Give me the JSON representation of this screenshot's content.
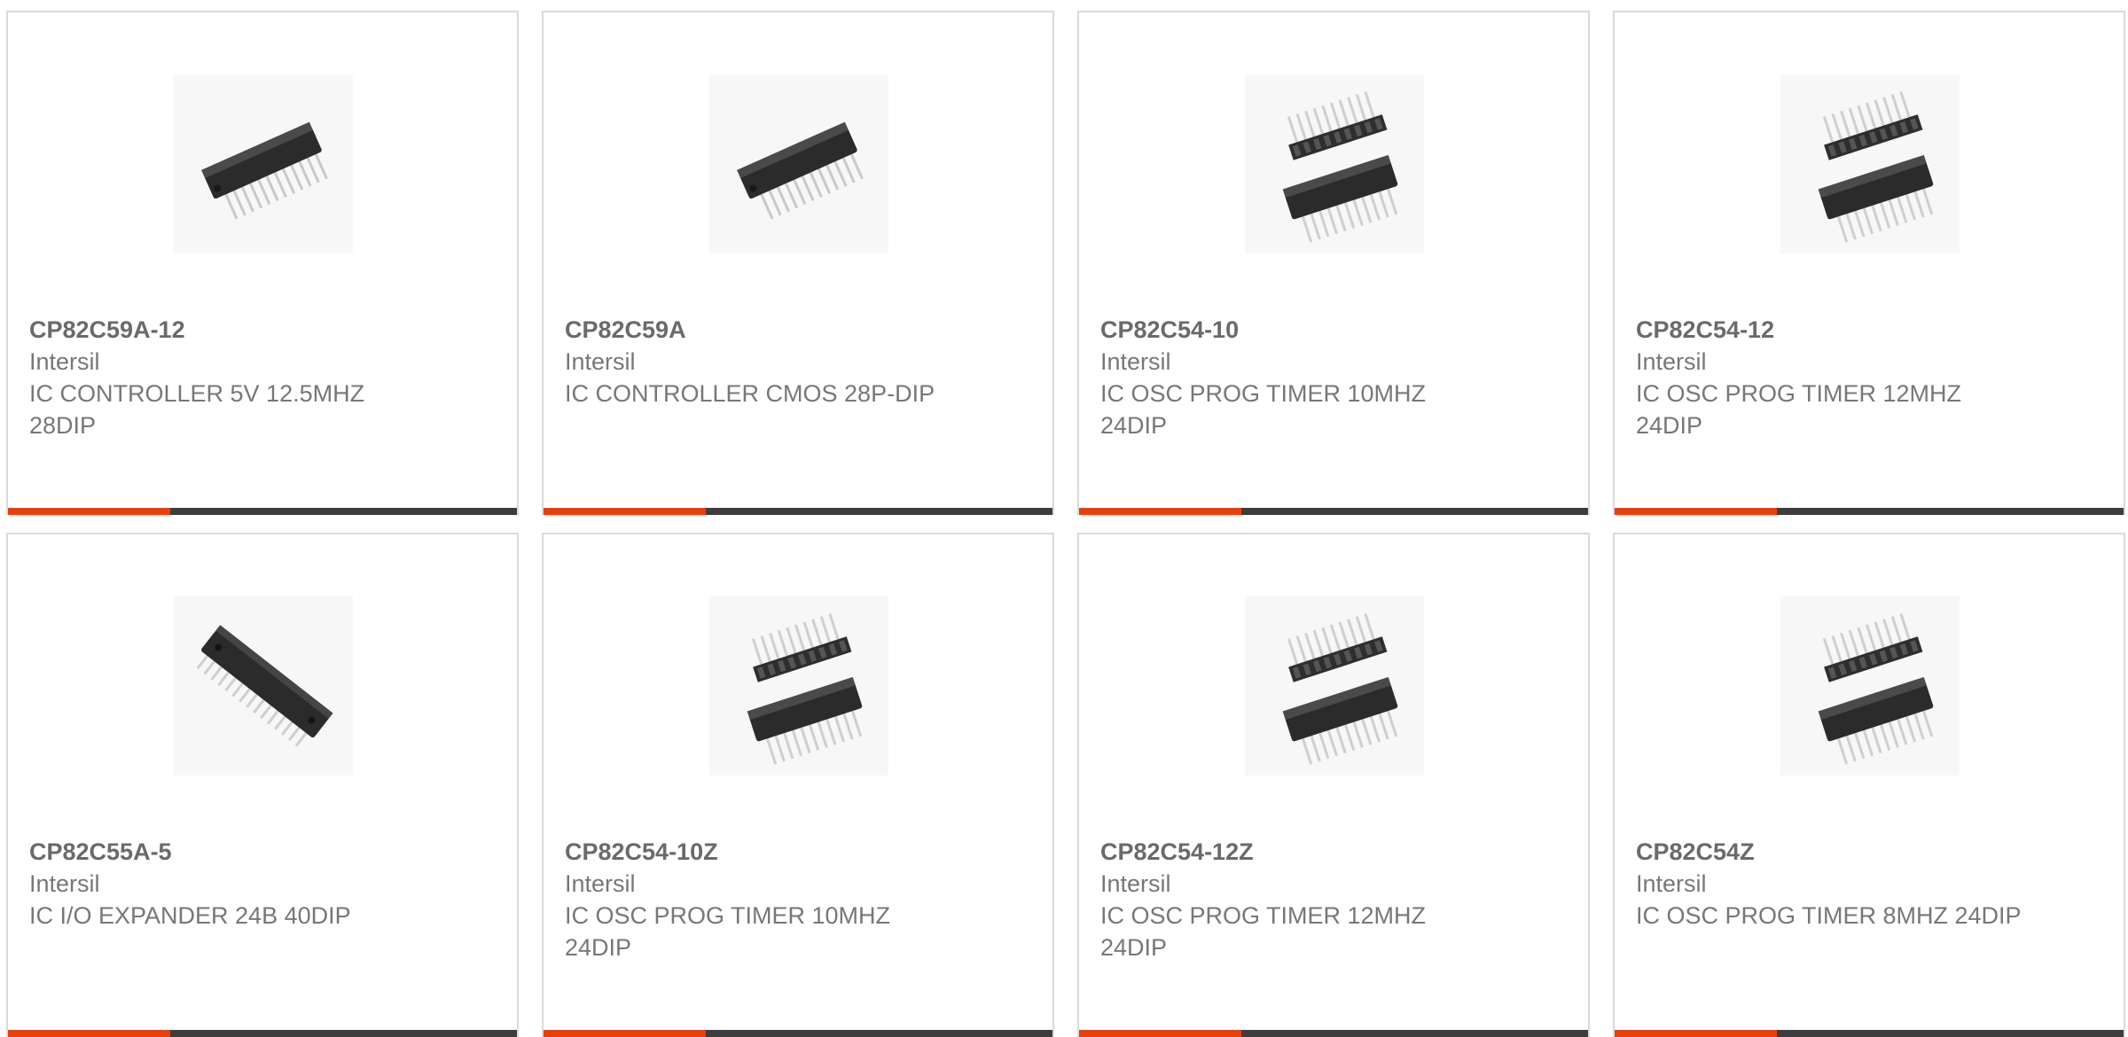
{
  "products": [
    {
      "part_number": "CP82C59A-12",
      "manufacturer": "Intersil",
      "description": "IC CONTROLLER 5V 12.5MHZ 28DIP",
      "image_icon": "dip-ic-chip-icon"
    },
    {
      "part_number": "CP82C59A",
      "manufacturer": "Intersil",
      "description": "IC CONTROLLER CMOS 28P-DIP",
      "image_icon": "dip-ic-chip-icon"
    },
    {
      "part_number": "CP82C54-10",
      "manufacturer": "Intersil",
      "description": "IC OSC PROG TIMER 10MHZ 24DIP",
      "image_icon": "dip-ic-with-socket-icon"
    },
    {
      "part_number": "CP82C54-12",
      "manufacturer": "Intersil",
      "description": "IC OSC PROG TIMER 12MHZ 24DIP",
      "image_icon": "dip-ic-with-socket-icon"
    },
    {
      "part_number": "CP82C55A-5",
      "manufacturer": "Intersil",
      "description": "IC I/O EXPANDER 24B 40DIP",
      "image_icon": "dip-40-ic-chip-icon"
    },
    {
      "part_number": "CP82C54-10Z",
      "manufacturer": "Intersil",
      "description": "IC OSC PROG TIMER 10MHZ 24DIP",
      "image_icon": "dip-ic-with-socket-icon"
    },
    {
      "part_number": "CP82C54-12Z",
      "manufacturer": "Intersil",
      "description": "IC OSC PROG TIMER 12MHZ 24DIP",
      "image_icon": "dip-ic-with-socket-icon"
    },
    {
      "part_number": "CP82C54Z",
      "manufacturer": "Intersil",
      "description": "IC OSC PROG TIMER 8MHZ 24DIP",
      "image_icon": "dip-ic-with-socket-icon"
    }
  ],
  "colors": {
    "accent": "#e8400c",
    "bar": "#3d3d3d",
    "border": "#dadada",
    "text": "#777777"
  }
}
